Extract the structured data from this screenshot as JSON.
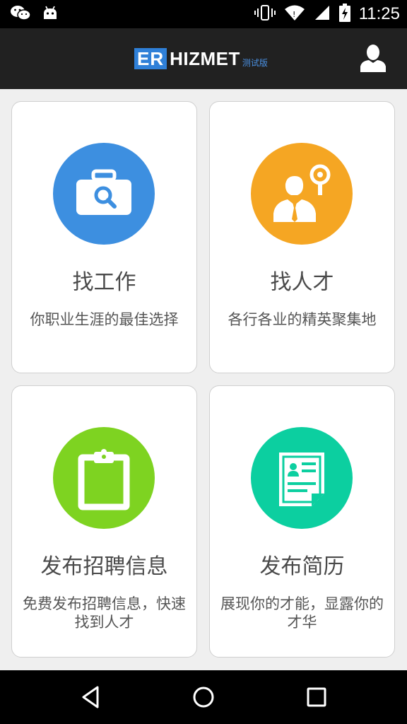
{
  "status_bar": {
    "time": "11:25",
    "icons": [
      "wechat-icon",
      "android-icon",
      "vibrate-icon",
      "wifi-icon",
      "signal-icon",
      "battery-charging-icon"
    ]
  },
  "app_bar": {
    "logo_er": "ER",
    "logo_name": "HIZMET",
    "logo_beta": "测试版",
    "accent": "#2f80d8",
    "user_icon": "user-icon"
  },
  "cards": [
    {
      "title": "找工作",
      "subtitle": "你职业生涯的最佳选择",
      "icon": "briefcase-search-icon",
      "color": "#3d8fe0"
    },
    {
      "title": "找人才",
      "subtitle": "各行各业的精英聚集地",
      "icon": "person-search-icon",
      "color": "#f5a623"
    },
    {
      "title": "发布招聘信息",
      "subtitle": "免费发布招聘信息，快速找到人才",
      "icon": "clipboard-icon",
      "color": "#7ed321"
    },
    {
      "title": "发布简历",
      "subtitle": "展现你的才能，显露你的才华",
      "icon": "resume-icon",
      "color": "#0ccfa0"
    }
  ],
  "nav_bar": {
    "icons": [
      "back-icon",
      "home-icon",
      "recents-icon"
    ]
  }
}
